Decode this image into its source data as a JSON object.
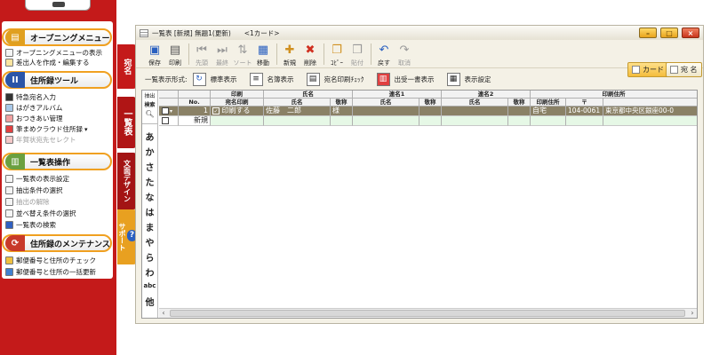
{
  "sidebar": {
    "sections": [
      {
        "title": "オープニングメニュー",
        "icon": "opening-menu-icon",
        "items": [
          {
            "label": "オープニングメニューの表示",
            "dim": false
          },
          {
            "label": "差出人を作成・編集する",
            "dim": false
          }
        ]
      },
      {
        "title": "住所録ツール",
        "icon": "address-tools-icon",
        "items": [
          {
            "label": "特急宛名入力",
            "dim": false
          },
          {
            "label": "はがきアルバム",
            "dim": false
          },
          {
            "label": "おつきあい管理",
            "dim": false
          },
          {
            "label": "筆まめクラウド住所録",
            "dim": false
          },
          {
            "label": "年賀状宛先セレクト",
            "dim": true
          }
        ]
      },
      {
        "title": "一覧表操作",
        "icon": "list-ops-icon",
        "items": [
          {
            "label": "一覧表の表示設定",
            "dim": false
          },
          {
            "label": "抽出条件の選択",
            "dim": false
          },
          {
            "label": "抽出の解除",
            "dim": true
          },
          {
            "label": "並べ替え条件の選択",
            "dim": false
          },
          {
            "label": "一覧表の検索",
            "dim": false
          }
        ]
      },
      {
        "title": "住所録のメンテナンス",
        "icon": "maintenance-icon",
        "items": [
          {
            "label": "郵便番号と住所のチェック",
            "dim": false
          },
          {
            "label": "郵便番号と住所の一括更新",
            "dim": false
          }
        ]
      }
    ]
  },
  "vertical_tabs": [
    {
      "label": "宛名",
      "color": "#c41a1a"
    },
    {
      "label": "一覧表",
      "color": "#c41a1a"
    },
    {
      "label": "文面デザイン",
      "color": "#a31414"
    },
    {
      "label": "サポート",
      "color": "#e8a020"
    }
  ],
  "window": {
    "title": "一覧表 [新規] 無題1(更新)　　<1カード>",
    "buttons": {
      "minimize": "–",
      "maximize": "□",
      "close": "×"
    }
  },
  "toolbar": {
    "buttons": [
      {
        "label": "保存",
        "icon": "save-icon",
        "glyph": "▣",
        "dim": false
      },
      {
        "label": "印刷",
        "icon": "print-icon",
        "glyph": "▤",
        "dim": false
      },
      {
        "label": "先頭",
        "icon": "first-icon",
        "glyph": "⏮",
        "dim": true
      },
      {
        "label": "最終",
        "icon": "last-icon",
        "glyph": "⏭",
        "dim": true
      },
      {
        "label": "ソート",
        "icon": "sort-icon",
        "glyph": "⇅",
        "dim": true
      },
      {
        "label": "移動",
        "icon": "move-icon",
        "glyph": "▦",
        "dim": false
      },
      {
        "label": "新規",
        "icon": "new-icon",
        "glyph": "✚",
        "dim": false
      },
      {
        "label": "削除",
        "icon": "delete-icon",
        "glyph": "✖",
        "dim": false
      },
      {
        "label": "ｺﾋﾟｰ",
        "icon": "copy-icon",
        "glyph": "❐",
        "dim": false
      },
      {
        "label": "貼付",
        "icon": "paste-icon",
        "glyph": "❒",
        "dim": true
      },
      {
        "label": "戻す",
        "icon": "undo-icon",
        "glyph": "↶",
        "dim": false
      },
      {
        "label": "取消",
        "icon": "redo-icon",
        "glyph": "↷",
        "dim": true
      }
    ],
    "card_tab": "カード",
    "address_tab": "宛 名"
  },
  "display_bar": {
    "label": "一覧表示形式:",
    "options": [
      {
        "label": "標準表示",
        "icon": "standard-view-icon"
      },
      {
        "label": "名簿表示",
        "icon": "roster-view-icon"
      },
      {
        "label": "宛名印刷ﾁｪｯｸ",
        "icon": "print-check-icon"
      },
      {
        "label": "出受一書表示",
        "icon": "send-receive-icon"
      },
      {
        "label": "表示設定",
        "icon": "display-settings-icon"
      }
    ]
  },
  "index": {
    "head_top": "抽出",
    "head_bottom": "検索",
    "kana": [
      "あ",
      "か",
      "さ",
      "た",
      "な",
      "は",
      "ま",
      "や",
      "ら",
      "わ",
      "abc",
      "他"
    ]
  },
  "grid": {
    "header_top": [
      "",
      "",
      "",
      "印刷",
      "氏名",
      "",
      "連名1",
      "",
      "連名2",
      "",
      "",
      "印刷住所"
    ],
    "header_bottom": [
      "",
      "",
      "No.",
      "宛名印刷",
      "氏名",
      "敬称",
      "氏名",
      "敬称",
      "氏名",
      "敬称",
      "印刷住所",
      "〒",
      ""
    ],
    "rows": [
      {
        "no": "1",
        "print": "印刷する",
        "name": "佐藤　二郎",
        "honorific": "様",
        "ren1_name": "",
        "ren1_hon": "",
        "ren2_name": "",
        "ren2_hon": "",
        "addr_type": "自宅",
        "zip": "104-0061",
        "address": "東京都中央区銀座00-0"
      }
    ],
    "new_row_label": "新規"
  }
}
